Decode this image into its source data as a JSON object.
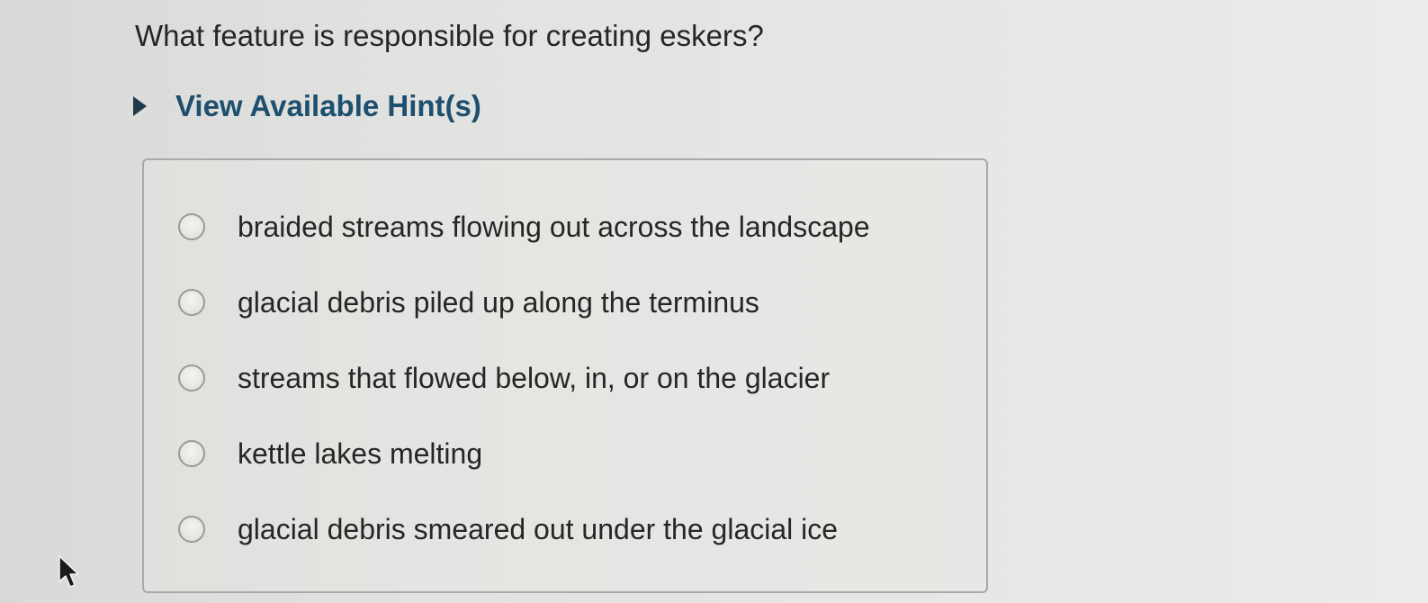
{
  "question": {
    "text": "What feature is responsible for creating eskers?"
  },
  "hints": {
    "label": "View Available Hint(s)"
  },
  "options": [
    {
      "label": "braided streams flowing out across the landscape",
      "selected": false
    },
    {
      "label": "glacial debris piled up along the terminus",
      "selected": false
    },
    {
      "label": "streams that flowed below, in, or on the glacier",
      "selected": false
    },
    {
      "label": "kettle lakes melting",
      "selected": false
    },
    {
      "label": "glacial debris smeared out under the glacial ice",
      "selected": false
    }
  ],
  "colors": {
    "hint_text": "#1d4f6e",
    "question_text": "#262626",
    "box_border": "#a9a9a7"
  },
  "icons": {
    "hint_caret": "caret-right-icon",
    "radio": "radio-button",
    "pointer": "mouse-pointer-icon"
  }
}
